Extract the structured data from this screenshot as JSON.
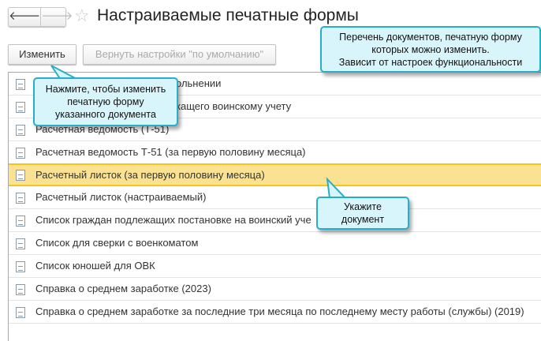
{
  "header": {
    "back": "🡐",
    "forward": "🡒",
    "title": "Настраиваемые печатные формы"
  },
  "toolbar": {
    "edit": "Изменить",
    "reset": "Вернуть настройки \"по умолчанию\""
  },
  "rows": [
    {
      "label": "ольнении"
    },
    {
      "label": "кащего воинскому учету"
    },
    {
      "label": "Расчетная ведомость (Т-51)"
    },
    {
      "label": "Расчетная ведомость Т-51 (за первую половину месяца)"
    },
    {
      "label": "Расчетный листок (за первую половину месяца)",
      "selected": true
    },
    {
      "label": "Расчетный листок (настраиваемый)"
    },
    {
      "label": "Список граждан подлежащих постановке на воинский уче"
    },
    {
      "label": "Список для сверки с военкоматом"
    },
    {
      "label": "Список юношей для ОВК"
    },
    {
      "label": "Справка о среднем заработке (2023)"
    },
    {
      "label": "Справка о среднем заработке за последние три месяца по последнему месту работы (службы) (2019)"
    }
  ],
  "tooltips": {
    "edit": [
      "Нажмите, чтобы изменить",
      "печатную форму",
      "указанного документа"
    ],
    "list": [
      "Перечень документов, печатную форму",
      "которых можно изменить.",
      "Зависит от настроек функциональности"
    ],
    "select": [
      "Укажите",
      "документ"
    ]
  }
}
